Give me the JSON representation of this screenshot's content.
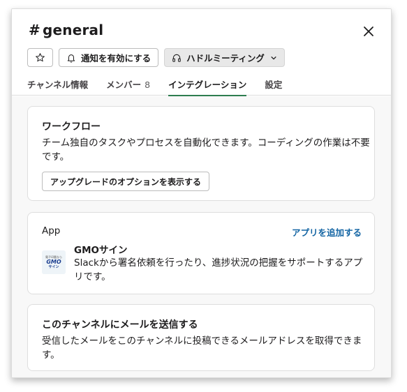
{
  "header": {
    "hash": "#",
    "channel_name": "general",
    "notify_label": "通知を有効にする",
    "huddle_label": "ハドルミーティング"
  },
  "tabs": [
    {
      "label": "チャンネル情報"
    },
    {
      "label": "メンバー",
      "count": "8"
    },
    {
      "label": "インテグレーション",
      "active": true
    },
    {
      "label": "設定"
    }
  ],
  "workflow": {
    "title": "ワークフロー",
    "description": "チーム独自のタスクやプロセスを自動化できます。コーディングの作業は不要です。",
    "upgrade_label": "アップグレードのオプションを表示する"
  },
  "apps": {
    "heading": "App",
    "add_label": "アプリを追加する",
    "items": [
      {
        "name": "GMOサイン",
        "description": "Slackから署名依頼を行ったり、進捗状況の把握をサポートするアプリです。",
        "logo_line1": "電子印鑑なら",
        "logo_line2": "GMO",
        "logo_line3": "サイン"
      }
    ]
  },
  "email": {
    "title": "このチャンネルにメールを送信する",
    "description": "受信したメールをこのチャンネルに投稿できるメールアドレスを取得できます。"
  },
  "colors": {
    "active_tab_underline": "#2e7d4f",
    "link": "#1264a3"
  }
}
